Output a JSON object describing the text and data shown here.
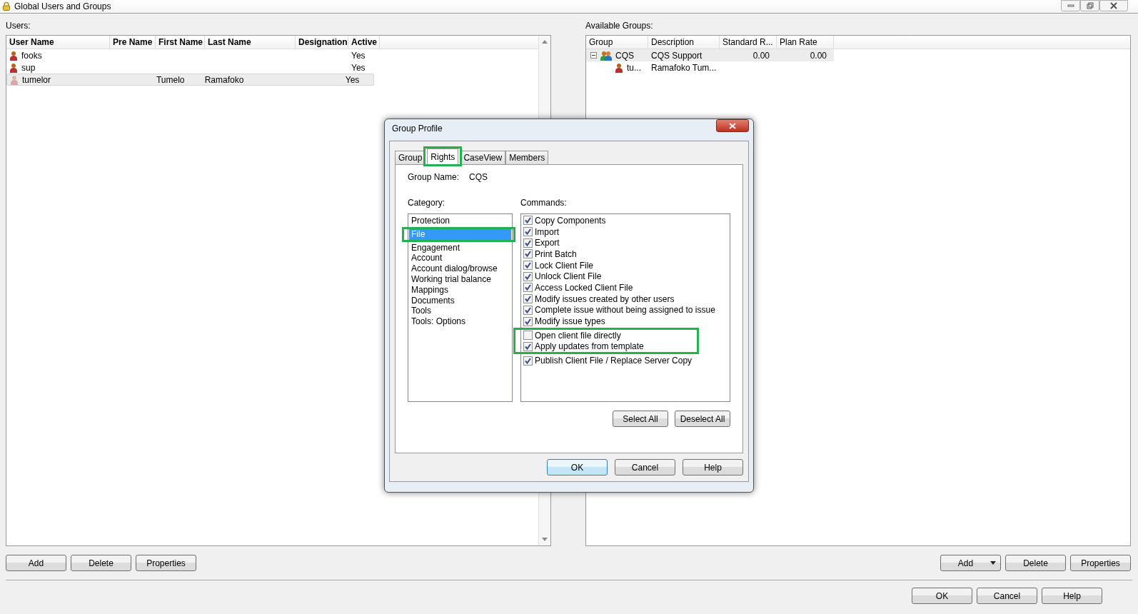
{
  "window": {
    "title": "Global Users and Groups"
  },
  "users": {
    "label": "Users:",
    "columns": [
      "User Name",
      "Pre Name",
      "First Name",
      "Last Name",
      "Designation",
      "Active"
    ],
    "rows": [
      {
        "user_name": "fooks",
        "active": "Yes",
        "selected": false
      },
      {
        "user_name": "sup",
        "active": "Yes",
        "selected": false
      },
      {
        "user_name": "tumelor",
        "first_name": "Tumelo",
        "last_name": "Ramafoko",
        "active": "Yes",
        "selected": true
      }
    ]
  },
  "groups": {
    "label": "Available Groups:",
    "columns": [
      "Group",
      "Description",
      "Standard R...",
      "Plan Rate"
    ],
    "rows": [
      {
        "group": "CQS",
        "description": "CQS Support",
        "standard_rate": "0.00",
        "plan_rate": "0.00",
        "expanded": true,
        "selected": true,
        "children": [
          {
            "group": "tu...",
            "description": "Ramafoko Tum..."
          }
        ]
      }
    ]
  },
  "user_buttons": [
    "Add",
    "Delete",
    "Properties"
  ],
  "group_buttons": [
    {
      "label": "Add",
      "kind": "split"
    },
    {
      "label": "Delete",
      "kind": "plain"
    },
    {
      "label": "Properties",
      "kind": "plain"
    }
  ],
  "footer_buttons": [
    "OK",
    "Cancel",
    "Help"
  ],
  "dialog": {
    "title": "Group Profile",
    "tabs": [
      {
        "label": "Group",
        "selected": false
      },
      {
        "label": "Rights",
        "selected": true,
        "highlighted": true
      },
      {
        "label": "CaseView",
        "selected": false
      },
      {
        "label": "Members",
        "selected": false
      }
    ],
    "group_name_label": "Group Name:",
    "group_name": "CQS",
    "category_label": "Category:",
    "categories": [
      {
        "label": "Protection",
        "selected": false
      },
      {
        "label": "File",
        "selected": true,
        "highlighted": true
      },
      {
        "label": "Engagement",
        "selected": false
      },
      {
        "label": "Account",
        "selected": false
      },
      {
        "label": "Account dialog/browse",
        "selected": false
      },
      {
        "label": "Working trial balance",
        "selected": false
      },
      {
        "label": "Mappings",
        "selected": false
      },
      {
        "label": "Documents",
        "selected": false
      },
      {
        "label": "Tools",
        "selected": false
      },
      {
        "label": "Tools: Options",
        "selected": false
      }
    ],
    "commands_label": "Commands:",
    "commands": [
      {
        "label": "Copy Components",
        "checked": true
      },
      {
        "label": "Import",
        "checked": true
      },
      {
        "label": "Export",
        "checked": true
      },
      {
        "label": "Print Batch",
        "checked": true
      },
      {
        "label": "Lock Client File",
        "checked": true
      },
      {
        "label": "Unlock Client File",
        "checked": true
      },
      {
        "label": "Access Locked Client File",
        "checked": true
      },
      {
        "label": "Modify issues created by other users",
        "checked": true
      },
      {
        "label": "Complete issue without being assigned to issue",
        "checked": true
      },
      {
        "label": "Modify issue types",
        "checked": true
      },
      {
        "label": "Open client file directly",
        "checked": false,
        "highlighted": true
      },
      {
        "label": "Apply updates from template",
        "checked": true,
        "highlighted": true
      },
      {
        "label": "Publish Client File / Replace Server Copy",
        "checked": true
      }
    ],
    "list_buttons": [
      "Select All",
      "Deselect All"
    ],
    "buttons": [
      {
        "label": "OK",
        "default": true
      },
      {
        "label": "Cancel",
        "default": false
      },
      {
        "label": "Help",
        "default": false
      }
    ]
  }
}
